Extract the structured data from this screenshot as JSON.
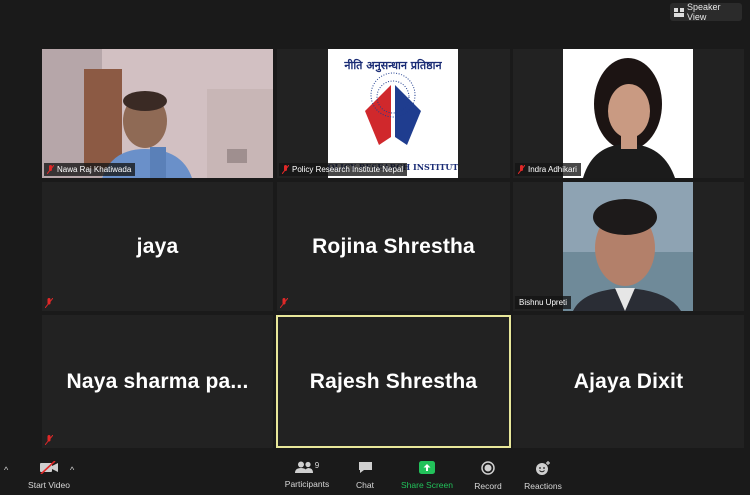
{
  "top_bar": {
    "speaker_view_label": "Speaker View"
  },
  "participants_tiles": [
    {
      "name": "Nawa Raj Khatiwada",
      "video": true
    },
    {
      "name": "Policy Research Institute Nepal",
      "video": true
    },
    {
      "name": "Indra Adhikari",
      "video": true
    },
    {
      "name": "jaya",
      "video": false
    },
    {
      "name": "Rojina Shrestha",
      "video": false
    },
    {
      "name": "Bishnu Upreti",
      "video": true
    },
    {
      "name": "Naya sharma pa...",
      "video": false
    },
    {
      "name": "Rajesh Shrestha",
      "video": false,
      "active_speaker": true
    },
    {
      "name": "Ajaya Dixit",
      "video": false
    }
  ],
  "logo": {
    "text_top": "नीति अनुसन्धान प्रतिष्ठान",
    "text_bottom": "POLICY RESEARCH INSTITUTE"
  },
  "toolbar": {
    "start_video": "Start Video",
    "participants": "Participants",
    "participants_count": "9",
    "chat": "Chat",
    "share_screen": "Share Screen",
    "record": "Record",
    "reactions": "Reactions"
  },
  "colors": {
    "active_border": "#e8e79a",
    "share_green": "#22c15a",
    "muted_red": "#e02828",
    "background": "#1a1a1a",
    "tile": "#222222"
  }
}
